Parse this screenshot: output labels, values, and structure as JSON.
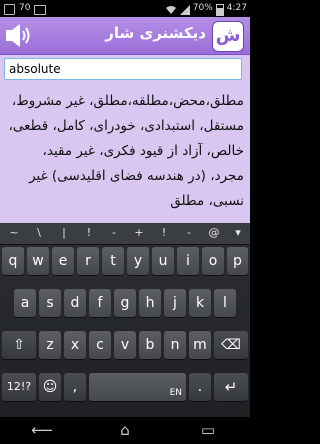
{
  "status_bar": {
    "notification_count": "70",
    "battery_percent": "70%",
    "time": "4:27"
  },
  "header": {
    "title": "دیکشنری شار",
    "logo_text": "ش",
    "speaker_icon": "speaker-icon",
    "accent_color": "#9a6fd8"
  },
  "search": {
    "value": "absolute"
  },
  "meaning": {
    "text": "مطلق،محض،مطلقه،مطلق، غیر مشروط، مستقل، استبدادی، خودرای، کامل، قطعی، خالص، آزاد از قیود فکری، غیر مقید، مجرد، (در هندسه فضای اقلیدسی) غیر نسبی، مطلق"
  },
  "keyboard": {
    "symbols": [
      "~",
      "\\",
      "|",
      "!",
      "-",
      "+",
      "!",
      "-",
      "@",
      "▾"
    ],
    "row1": [
      "q",
      "w",
      "e",
      "r",
      "t",
      "y",
      "u",
      "i",
      "o",
      "p"
    ],
    "row2": [
      "a",
      "s",
      "d",
      "f",
      "g",
      "h",
      "j",
      "k",
      "l"
    ],
    "row3": [
      "z",
      "x",
      "c",
      "v",
      "b",
      "n",
      "m"
    ],
    "shift": "⇧",
    "backspace": "⌫",
    "mode_key": "12!?",
    "emoji_key": "☺",
    "comma_key": ",",
    "space_key": "EN",
    "period_key": ".",
    "enter_key": "↵"
  },
  "nav": {
    "back": "⟵",
    "home": "⌂",
    "recents": "▭"
  }
}
